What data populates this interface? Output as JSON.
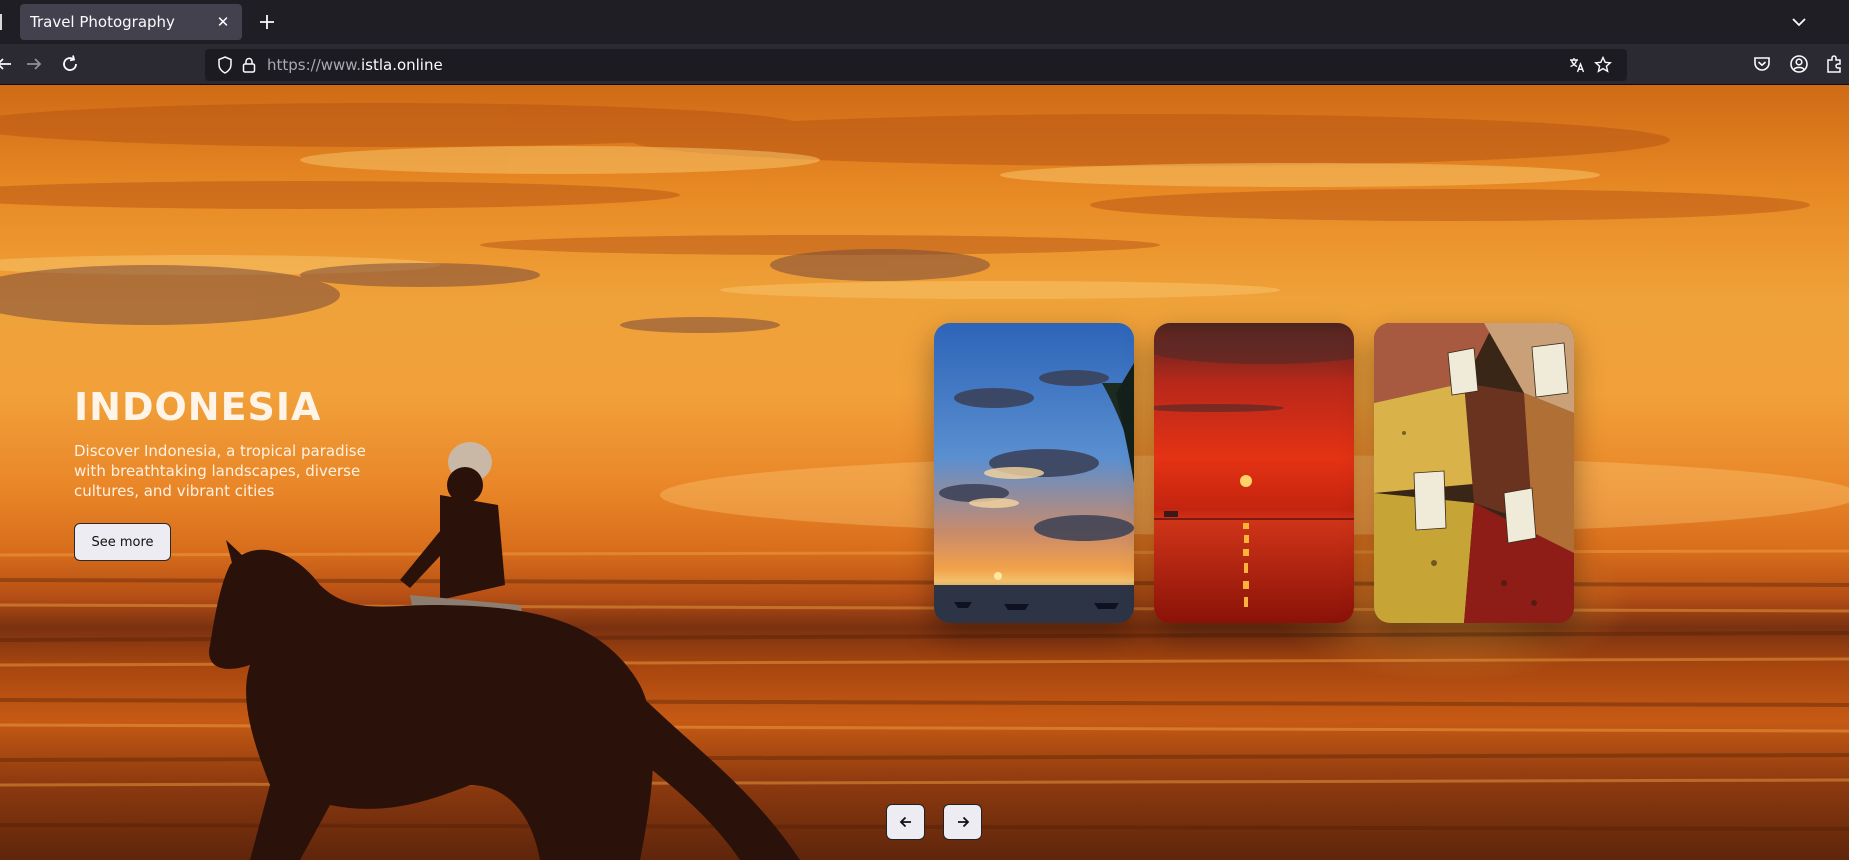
{
  "browser": {
    "tab_title": "Travel Photography",
    "url_prefix": "https://www.",
    "url_domain": "istla.online",
    "icons": {
      "back": "back-arrow-icon",
      "forward": "forward-arrow-icon",
      "reload": "reload-icon",
      "shield": "tracking-shield-icon",
      "lock": "lock-icon",
      "translate": "translate-icon",
      "bookmark": "star-icon",
      "pocket": "pocket-icon",
      "account": "account-icon",
      "extensions": "extensions-icon",
      "new_tab": "plus-icon",
      "tab_list": "chevron-down-icon",
      "close_tab": "close-icon"
    }
  },
  "hero": {
    "title": "INDONESIA",
    "description": "Discover Indonesia, a tropical paradise with breathtaking landscapes, diverse cultures, and vibrant cities",
    "cta_label": "See more"
  },
  "carousel": {
    "cards": [
      {
        "name": "blue-sky-sunset-card"
      },
      {
        "name": "red-sunset-sea-card"
      },
      {
        "name": "spice-market-card"
      }
    ],
    "prev_icon": "arrow-left-icon",
    "next_icon": "arrow-right-icon"
  },
  "colors": {
    "chrome_dark": "#1f1e25",
    "toolbar": "#2b2a33",
    "sunset_orange": "#f0a23a",
    "button_bg": "#ececf2"
  }
}
